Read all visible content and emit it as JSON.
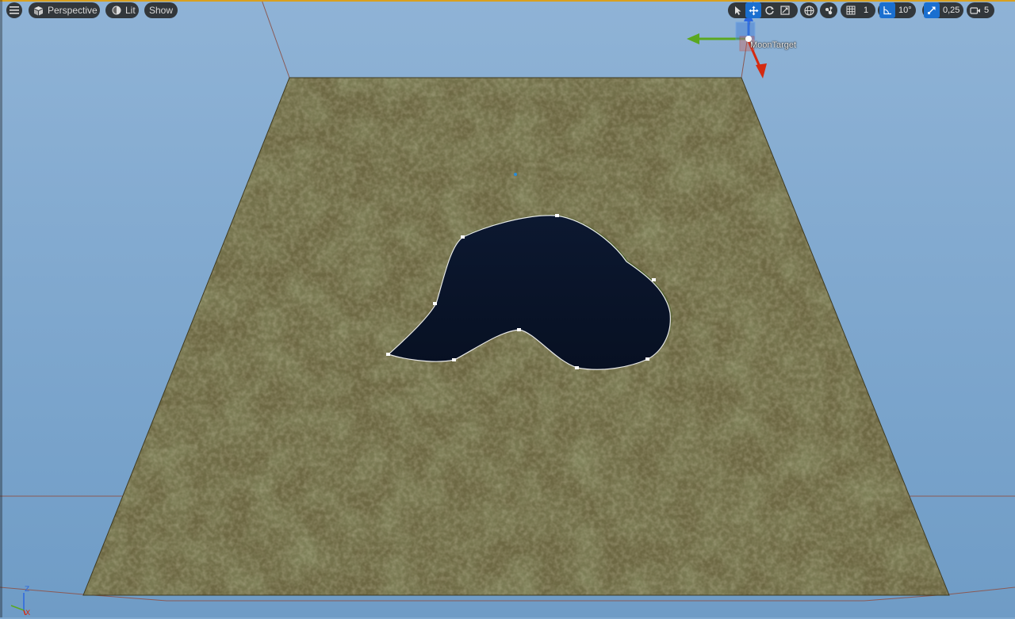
{
  "viewport": {
    "view_mode": "Perspective",
    "lighting_mode": "Lit",
    "show_label": "Show",
    "grid_snap_value": "1",
    "rotation_snap_value": "10°",
    "scale_snap_value": "0,25",
    "camera_speed_value": "5",
    "selected_actor_label": "MoonTarget",
    "axis_labels": {
      "z": "Z",
      "x": "X"
    }
  },
  "icons": {
    "menu": "hamburger-menu-icon",
    "view_mode": "perspective-cube-icon",
    "lit": "lit-sphere-icon",
    "select": "select-cursor-icon",
    "translate": "translate-arrows-icon",
    "rotate": "rotate-icon",
    "scale": "scale-icon",
    "world_local": "world-globe-icon",
    "surface_snap": "surface-snap-icon",
    "grid_snap": "grid-icon",
    "rotation_snap": "angle-icon",
    "scale_snap": "scale-snap-icon",
    "camera_speed": "camera-icon"
  },
  "colors": {
    "sky": "#7ea7cf",
    "accent": "#1a6fd0",
    "lake": "#0a1426",
    "terrain": "#6f6a44",
    "gizmo_x": "#d42a10",
    "gizmo_y": "#5aa820",
    "gizmo_z": "#2a66e0"
  }
}
